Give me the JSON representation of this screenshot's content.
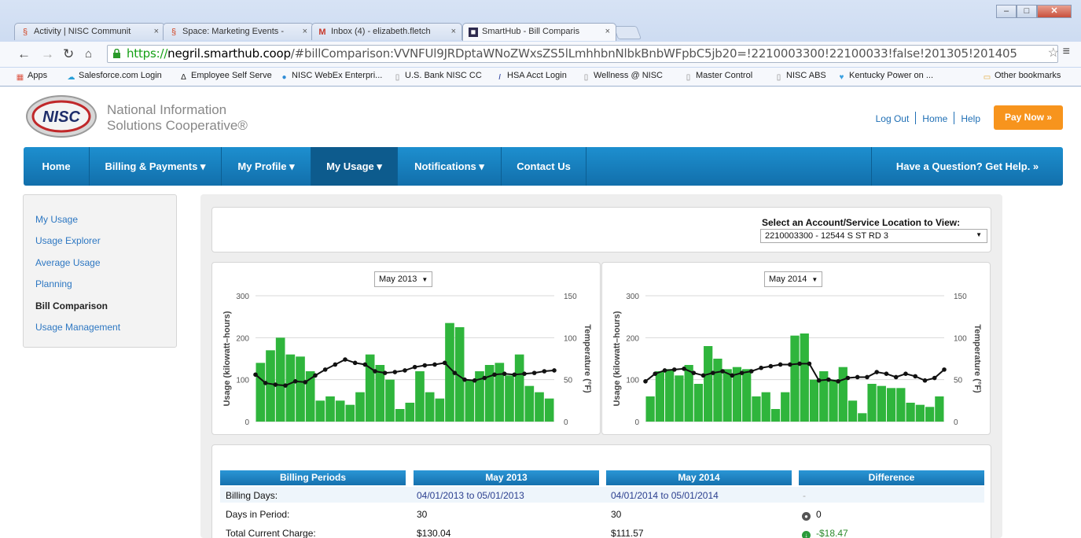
{
  "browser": {
    "tabs": [
      {
        "label": "Activity | NISC Communit",
        "icon": "confluence-icon"
      },
      {
        "label": "Space: Marketing Events - ",
        "icon": "confluence-icon"
      },
      {
        "label": "Inbox (4) - elizabeth.fletch",
        "icon": "gmail-icon"
      },
      {
        "label": "SmartHub - Bill Comparis",
        "icon": "smarthub-icon"
      }
    ],
    "url_scheme": "https://",
    "url_host": "negril.smarthub.coop",
    "url_rest": "/#billComparison:VVNFUl9JRDptaWNoZWxsZS5lLmhhbnNlbkBnbWFpbC5jb20=!2210003300!22100033!false!201305!201405",
    "bookmarks": [
      "Apps",
      "Salesforce.com Login",
      "Employee Self Serve",
      "NISC WebEx Enterpri...",
      "U.S. Bank NISC CC",
      "HSA Acct Login",
      "Wellness @ NISC",
      "Master Control",
      "NISC ABS",
      "Kentucky Power on ..."
    ],
    "other_bookmarks": "Other bookmarks"
  },
  "header": {
    "logo_text": "NISC",
    "org_line1": "National Information",
    "org_line2": "Solutions Cooperative®",
    "logout": "Log Out",
    "home": "Home",
    "help": "Help",
    "pay_now": "Pay Now »"
  },
  "nav": {
    "items": [
      "Home",
      "Billing & Payments ▾",
      "My Profile ▾",
      "My Usage ▾",
      "Notifications ▾",
      "Contact Us"
    ],
    "help": "Have a Question? Get Help. »"
  },
  "sidebar": {
    "items": [
      "My Usage",
      "Usage Explorer",
      "Average Usage",
      "Planning",
      "Bill Comparison",
      "Usage Management"
    ]
  },
  "account": {
    "label": "Select an Account/Service Location to View:",
    "selected": "2210003300 - 12544 S ST RD 3"
  },
  "chart_data": [
    {
      "type": "bar",
      "selector": "May 2013",
      "ylabel": "Usage (kilowatt–hours)",
      "y2label": "Temperature (°F)",
      "ylim": [
        0,
        300
      ],
      "y2lim": [
        0,
        150
      ],
      "yticks": [
        "300",
        "200",
        "100",
        "0"
      ],
      "y2ticks": [
        "150",
        "100",
        "50",
        "0"
      ],
      "bar_color": "#2fb53c",
      "line_color": "#111111",
      "values": [
        140,
        170,
        200,
        160,
        155,
        120,
        50,
        60,
        50,
        40,
        70,
        160,
        135,
        100,
        30,
        45,
        120,
        70,
        55,
        235,
        225,
        100,
        120,
        135,
        140,
        110,
        160,
        85,
        70,
        55
      ],
      "temperature": [
        56,
        46,
        44,
        43,
        48,
        47,
        55,
        62,
        68,
        74,
        70,
        68,
        60,
        58,
        59,
        61,
        65,
        67,
        68,
        70,
        58,
        50,
        49,
        52,
        56,
        57,
        56,
        57,
        58,
        60,
        61
      ]
    },
    {
      "type": "bar",
      "selector": "May 2014",
      "ylabel": "Usage (kilowatt–hours)",
      "y2label": "Temperature (°F)",
      "ylim": [
        0,
        300
      ],
      "y2lim": [
        0,
        150
      ],
      "yticks": [
        "300",
        "200",
        "100",
        "0"
      ],
      "y2ticks": [
        "150",
        "100",
        "50",
        "0"
      ],
      "bar_color": "#2fb53c",
      "line_color": "#111111",
      "values": [
        60,
        120,
        125,
        110,
        135,
        90,
        180,
        150,
        125,
        130,
        125,
        60,
        70,
        30,
        70,
        205,
        210,
        100,
        120,
        100,
        130,
        50,
        20,
        90,
        85,
        80,
        80,
        45,
        40,
        35,
        60
      ],
      "temperature": [
        48,
        57,
        61,
        62,
        63,
        58,
        55,
        58,
        60,
        55,
        58,
        60,
        64,
        66,
        68,
        68,
        69,
        69,
        49,
        50,
        48,
        52,
        53,
        53,
        59,
        57,
        53,
        57,
        54,
        49,
        52,
        62
      ]
    }
  ],
  "comparison": {
    "headers": [
      "Billing Periods",
      "May 2013",
      "May 2014",
      "Difference"
    ],
    "rows": [
      {
        "label": "Billing Days:",
        "a": "04/01/2013 to 05/01/2013",
        "b": "04/01/2014 to 05/01/2014",
        "diff": "-"
      },
      {
        "label": "Days in Period:",
        "a": "30",
        "b": "30",
        "diff": "0"
      },
      {
        "label": "Total Current Charge:",
        "a": "$130.04",
        "b": "$111.57",
        "diff": "-$18.47"
      }
    ]
  }
}
